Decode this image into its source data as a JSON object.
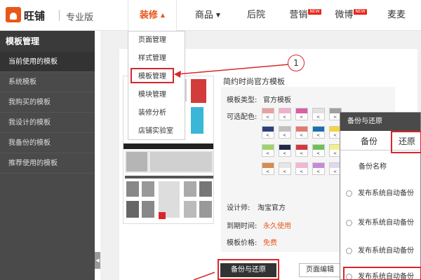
{
  "brand": {
    "logo_text": "旺铺",
    "edition": "专业版"
  },
  "nav": [
    {
      "label": "装修",
      "arrow": "▲",
      "badge": ""
    },
    {
      "label": "商品",
      "arrow": "▼",
      "badge": ""
    },
    {
      "label": "后院",
      "arrow": "",
      "badge": ""
    },
    {
      "label": "营销",
      "arrow": "",
      "badge": "NEW"
    },
    {
      "label": "微博",
      "arrow": "",
      "badge": "NEW"
    },
    {
      "label": "麦麦",
      "arrow": "",
      "badge": ""
    }
  ],
  "sidebar": {
    "title": "模板管理",
    "items": [
      "当前使用的模板",
      "系统模板",
      "我购买的模板",
      "我设计的模板",
      "我备份的模板",
      "推荐使用的模板"
    ]
  },
  "dropdown": {
    "items": [
      "页面管理",
      "样式管理",
      "模板管理",
      "模块管理",
      "装修分析",
      "店铺实验室"
    ]
  },
  "callout": "1",
  "template": {
    "name": "简约时尚官方模板",
    "type_label": "模板类型:",
    "type_value": "官方模板",
    "colors_label": "可选配色:",
    "designer_label": "设计师:",
    "designer_value": "淘宝官方",
    "expire_label": "到期时间:",
    "expire_value": "永久使用",
    "price_label": "模板价格:",
    "price_value": "免费"
  },
  "swatches": [
    "#e8a0a0",
    "#f0b0c8",
    "#d85fa0",
    "#e0e0e0",
    "#a0a0a0",
    "#2d3f7a",
    "#c0c0c0",
    "#e07a6f",
    "#1b6fb0",
    "#f4d43a",
    "#9ed36a",
    "#1e2a4a",
    "#d13a3a",
    "#6fbf5b",
    "#f3f08a",
    "#d88a4d",
    "#e6e6e6",
    "#f5b5d5",
    "#c88ad8",
    "#e0d8f0"
  ],
  "swatch_glyph": "<",
  "buttons": {
    "backup": "备份与还原",
    "page_edit": "页面编辑"
  },
  "dialog": {
    "title": "备份与还原",
    "tabs": [
      "备份",
      "还原"
    ],
    "col_header": "备份名称",
    "rows": [
      "发布系统自动备份",
      "发布系统自动备份",
      "发布系统自动备份",
      "发布系统自动备份"
    ]
  },
  "colors": {
    "accent": "#e8571a",
    "highlight": "#d9262b",
    "sidebar": "#4a4a4a"
  }
}
